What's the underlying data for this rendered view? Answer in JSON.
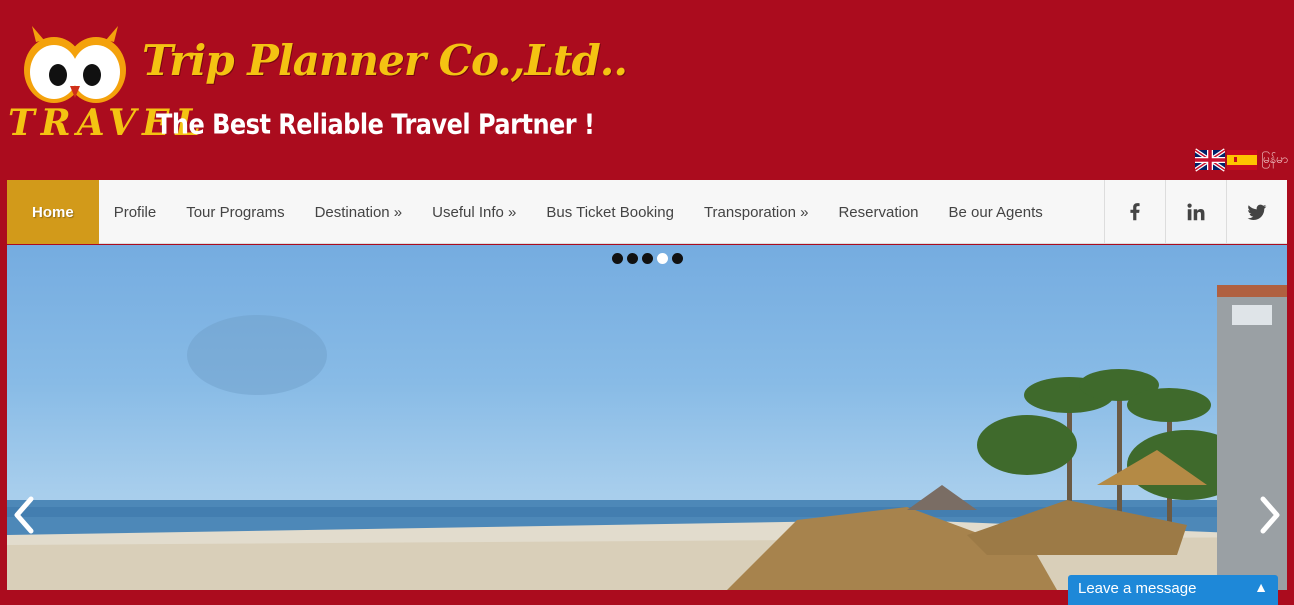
{
  "brand": {
    "name": "Trip Planner Co.,Ltd..",
    "travel": "TRAVEL",
    "tagline": "The Best Reliable Travel Partner !"
  },
  "languages": {
    "items": [
      "English",
      "Español"
    ],
    "myanmar_label": "မြန်မာ"
  },
  "nav": {
    "items": [
      "Home",
      "Profile",
      "Tour Programs",
      "Destination »",
      "Useful Info »",
      "Bus Ticket Booking",
      "Transporation »",
      "Reservation",
      "Be our Agents"
    ],
    "active": "Home",
    "social": [
      "facebook-icon",
      "linkedin-icon",
      "twitter-icon"
    ]
  },
  "slider": {
    "slide_count": 5,
    "current_slide": 4
  },
  "chat": {
    "label": "Leave a message"
  },
  "colors": {
    "background": "#ab0c1e",
    "brand_gold": "#f4c312",
    "nav_active": "#d29a1a",
    "chat": "#1e88d8"
  }
}
